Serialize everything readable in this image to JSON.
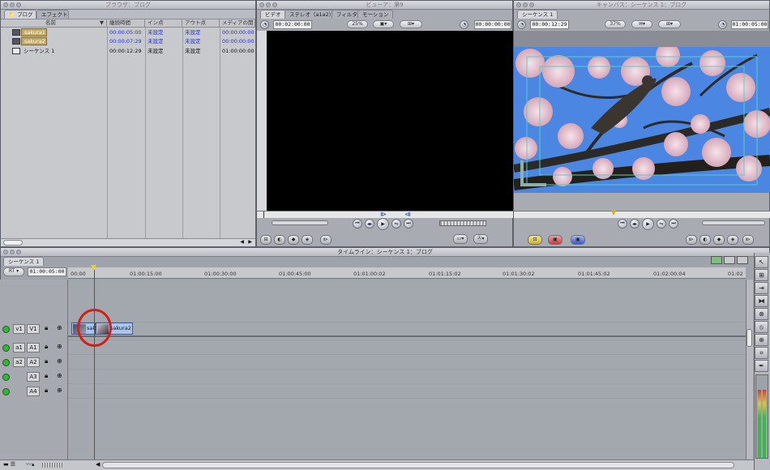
{
  "browser": {
    "title": "ブラウザ：ブログ",
    "tabs": [
      "ブログ",
      "エフェクト"
    ],
    "columns": [
      "名前",
      "継続時間",
      "イン点",
      "アウト点",
      "メディアの開"
    ],
    "rows": [
      {
        "name": "sakura1",
        "duration": "00:00:05:00",
        "in": "未設定",
        "out": "未設定",
        "media": "00:00:00:00",
        "type": "clip"
      },
      {
        "name": "sakura2",
        "duration": "00:00:07:29",
        "in": "未設定",
        "out": "未設定",
        "media": "00:00:00:00",
        "type": "clip"
      },
      {
        "name": "シーケンス 1",
        "duration": "00:00:12:29",
        "in": "未設定",
        "out": "未設定",
        "media": "01:00:00:00",
        "type": "sequence"
      }
    ]
  },
  "viewer": {
    "title": "ビューア：第9",
    "tabs": [
      "ビデオ",
      "ステレオ（a1a2）",
      "フィルタ",
      "モーション"
    ],
    "duration": "00:02:00:00",
    "zoom": "25%",
    "timecode": "00:00:00:00"
  },
  "canvas": {
    "title": "キャンバス：シーケンス 1：ブログ",
    "tab": "シーケンス 1",
    "duration": "00:00:12:29",
    "zoom": "37%",
    "timecode": "01:00:05:00"
  },
  "timeline": {
    "title": "タイムライン：シーケンス 1：ブログ",
    "tab": "シーケンス 1",
    "rt_label": "RT",
    "timecode": "01:00:05:00",
    "ruler": [
      "00:00",
      "01:00:15:00",
      "01:00:30:00",
      "01:00:45:00",
      "01:01:00:02",
      "01:01:15:02",
      "01:01:30:02",
      "01:01:45:02",
      "01:02:00:04",
      "01:02"
    ],
    "tracks": [
      {
        "src": "v1",
        "dst": "V1"
      },
      {
        "src": "a1",
        "dst": "A1"
      },
      {
        "src": "a2",
        "dst": "A2"
      },
      {
        "src": "",
        "dst": "A3"
      },
      {
        "src": "",
        "dst": "A4"
      }
    ],
    "clips": [
      {
        "label": "sak",
        "track": "V1"
      },
      {
        "label": "sakura2",
        "track": "V1"
      }
    ]
  },
  "colors": {
    "highlight_circle": "#d81e14",
    "clip_fill": "#a9c4ee",
    "playhead": "#e8d22a",
    "track_enable": "#37b23a"
  },
  "icons": [
    "browser-tab-icon",
    "clip-icon",
    "sequence-icon",
    "play-icon",
    "loop-icon",
    "mark-in-icon",
    "mark-out-icon",
    "track-enable-icon",
    "lock-icon",
    "link-icon",
    "tool-icons"
  ]
}
